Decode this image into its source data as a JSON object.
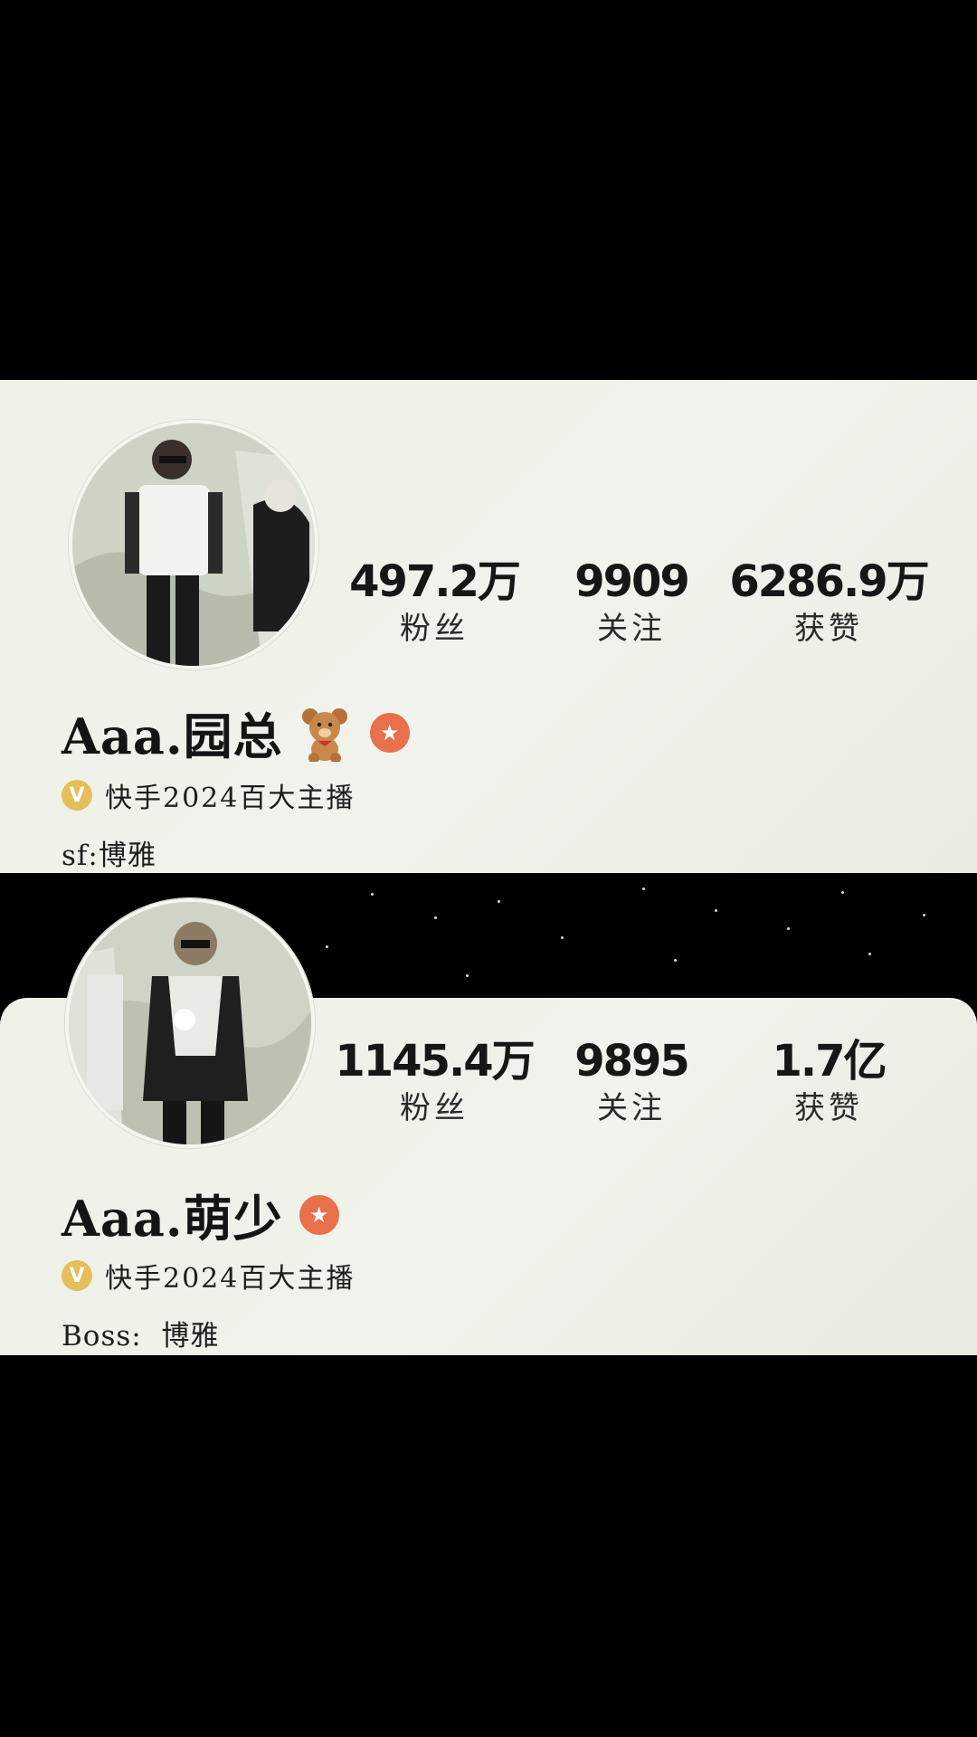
{
  "profiles": [
    {
      "name": "Aaa.园总",
      "stats": [
        {
          "value": "497.2万",
          "label": "粉丝"
        },
        {
          "value": "9909",
          "label": "关注"
        },
        {
          "value": "6286.9万",
          "label": "获赞"
        }
      ],
      "verified_badge": "V",
      "verified_text": "快手2024百大主播",
      "bio": "sf:博雅",
      "icons": [
        "teddy-bear-icon",
        "star-badge-icon",
        "verified-icon"
      ]
    },
    {
      "name": "Aaa.萌少",
      "stats": [
        {
          "value": "1145.4万",
          "label": "粉丝"
        },
        {
          "value": "9895",
          "label": "关注"
        },
        {
          "value": "1.7亿",
          "label": "获赞"
        }
      ],
      "verified_badge": "V",
      "verified_text": "快手2024百大主播",
      "bio": "Boss:  博雅",
      "icons": [
        "star-badge-icon",
        "verified-icon"
      ]
    }
  ],
  "colors": {
    "card_background": "#eef1e6",
    "star_badge": "#e8704a",
    "verified_badge": "#e5bf5c",
    "text": "#161616"
  }
}
